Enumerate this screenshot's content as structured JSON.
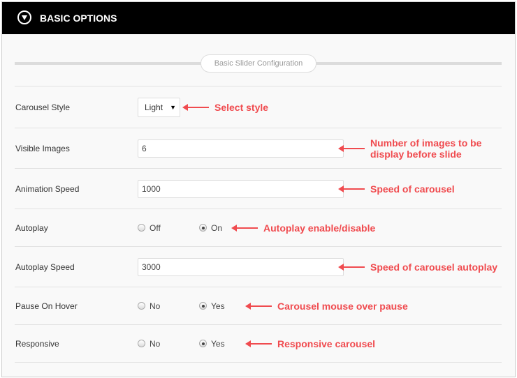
{
  "header": {
    "title": "BASIC OPTIONS",
    "toggle_icon": "chevron-down-circle-icon"
  },
  "section": {
    "title": "Basic Slider Configuration"
  },
  "colors": {
    "annotation": "#f04b4f",
    "header_bg": "#000000"
  },
  "rows": [
    {
      "label": "Carousel Style",
      "type": "select",
      "value": "Light",
      "annotation": "Select style"
    },
    {
      "label": "Visible Images",
      "type": "text",
      "value": "6",
      "annotation": "Number of images to be display before slide"
    },
    {
      "label": "Animation Speed",
      "type": "text",
      "value": "1000",
      "annotation": "Speed of carousel"
    },
    {
      "label": "Autoplay",
      "type": "radio",
      "options": [
        "Off",
        "On"
      ],
      "selected": "On",
      "annotation": "Autoplay enable/disable"
    },
    {
      "label": "Autoplay Speed",
      "type": "text",
      "value": "3000",
      "annotation": "Speed of carousel autoplay"
    },
    {
      "label": "Pause On Hover",
      "type": "radio",
      "options": [
        "No",
        "Yes"
      ],
      "selected": "Yes",
      "annotation": "Carousel mouse over pause"
    },
    {
      "label": "Responsive",
      "type": "radio",
      "options": [
        "No",
        "Yes"
      ],
      "selected": "Yes",
      "annotation": "Responsive carousel"
    }
  ]
}
